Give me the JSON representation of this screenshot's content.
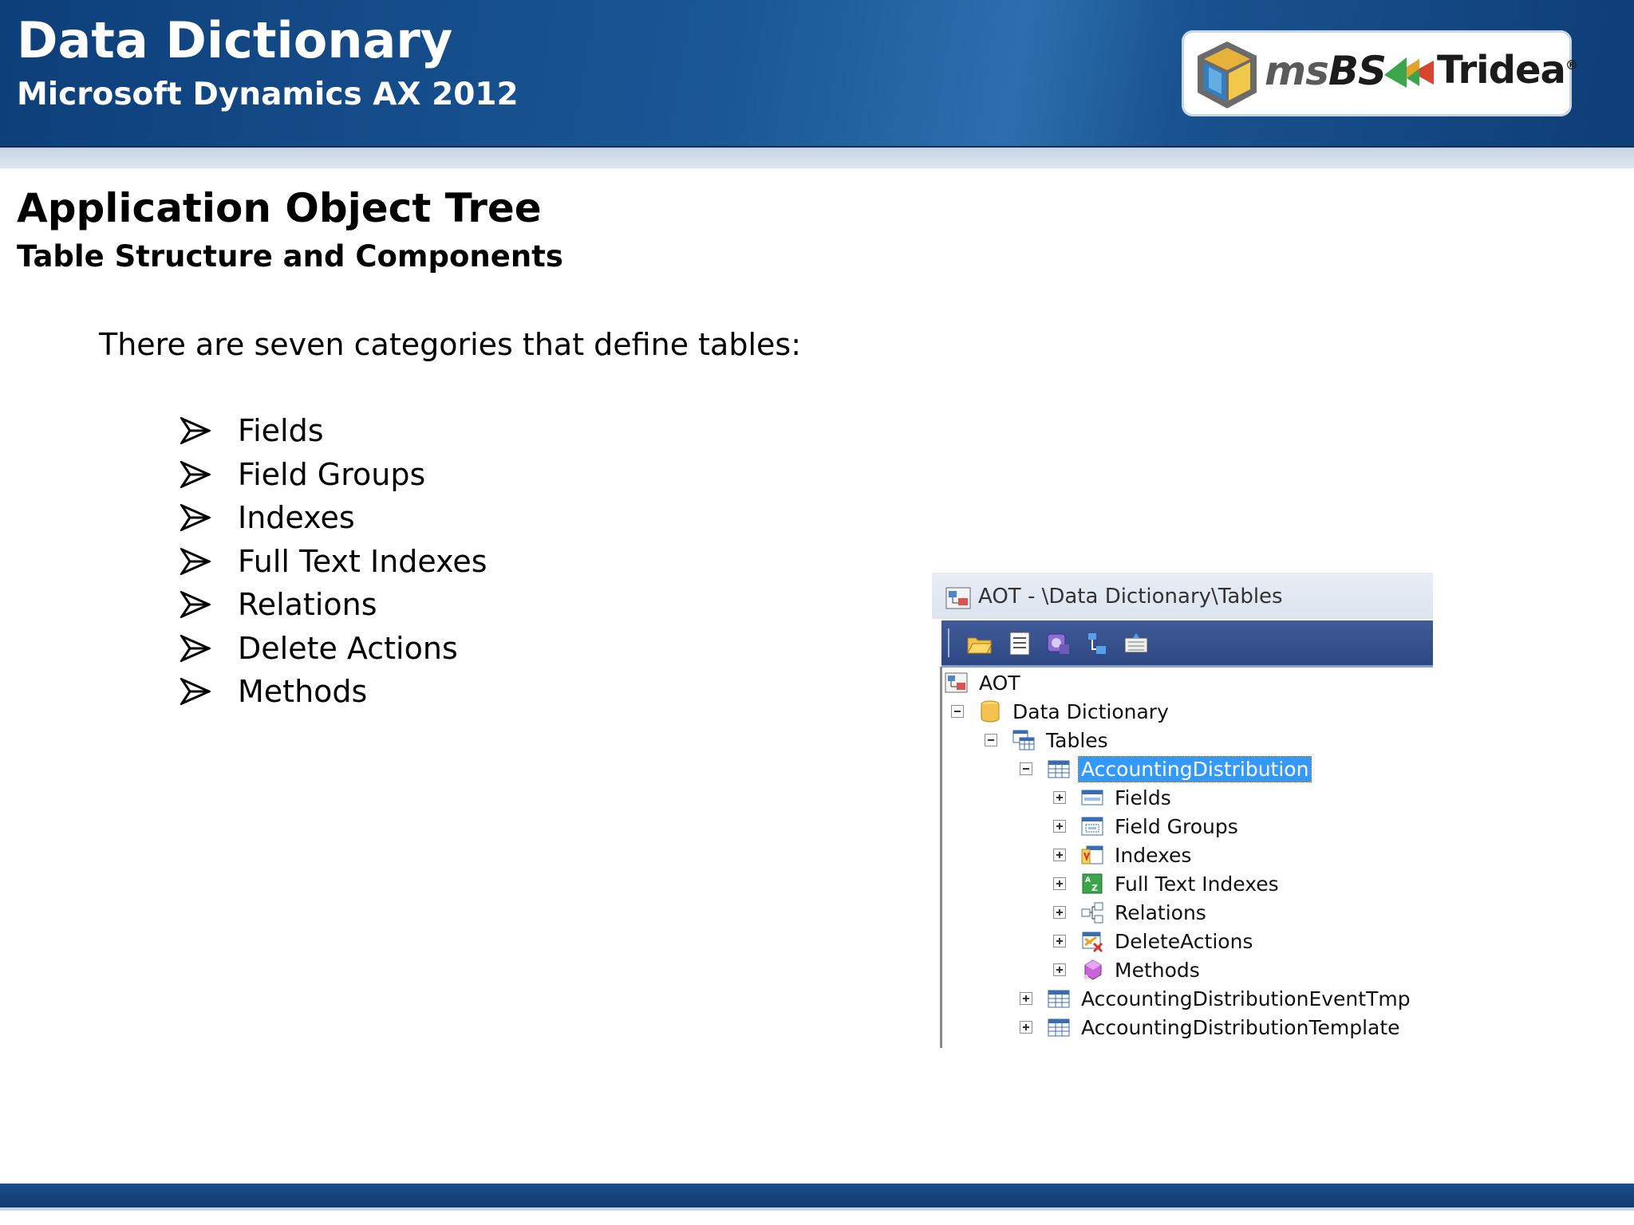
{
  "banner": {
    "title": "Data Dictionary",
    "subtitle": "Microsoft Dynamics AX 2012",
    "logo": {
      "brand1_prefix": "ms",
      "brand1_suffix": "BS",
      "brand2": "Tridea",
      "registered": "®"
    }
  },
  "slide": {
    "title": "Application Object Tree",
    "subtitle": "Table Structure and Components",
    "intro": "There are seven categories that define tables:",
    "bullet_icon": "arrow-bullet-icon",
    "bullets": [
      "Fields",
      "Field Groups",
      "Indexes",
      "Full Text Indexes",
      "Relations",
      "Delete Actions",
      "Methods"
    ]
  },
  "aot_window": {
    "title": "AOT - \\Data Dictionary\\Tables",
    "toolbar_icons": [
      "open-icon",
      "properties-icon",
      "compile-icon",
      "import-icon",
      "layout-icon"
    ],
    "tree": [
      {
        "label": "AOT",
        "icon": "aot-icon",
        "expander": "none"
      },
      {
        "label": "Data Dictionary",
        "icon": "database-icon",
        "expander": "minus"
      },
      {
        "label": "Tables",
        "icon": "tables-icon",
        "expander": "minus"
      },
      {
        "label": "AccountingDistribution",
        "icon": "table-icon",
        "expander": "minus",
        "selected": true
      },
      {
        "label": "Fields",
        "icon": "fields-icon",
        "expander": "plus"
      },
      {
        "label": "Field Groups",
        "icon": "field-groups-icon",
        "expander": "plus"
      },
      {
        "label": "Indexes",
        "icon": "indexes-icon",
        "expander": "plus"
      },
      {
        "label": "Full Text Indexes",
        "icon": "full-text-indexes-icon",
        "expander": "plus"
      },
      {
        "label": "Relations",
        "icon": "relations-icon",
        "expander": "plus"
      },
      {
        "label": "DeleteActions",
        "icon": "delete-actions-icon",
        "expander": "plus"
      },
      {
        "label": "Methods",
        "icon": "methods-icon",
        "expander": "plus"
      },
      {
        "label": "AccountingDistributionEventTmp",
        "icon": "table-icon",
        "expander": "plus"
      },
      {
        "label": "AccountingDistributionTemplate",
        "icon": "table-icon",
        "expander": "plus"
      }
    ]
  },
  "colors": {
    "banner_blue": "#1a5796",
    "selection_blue": "#3399ff",
    "toolbar_blue": "#3f5a98"
  }
}
